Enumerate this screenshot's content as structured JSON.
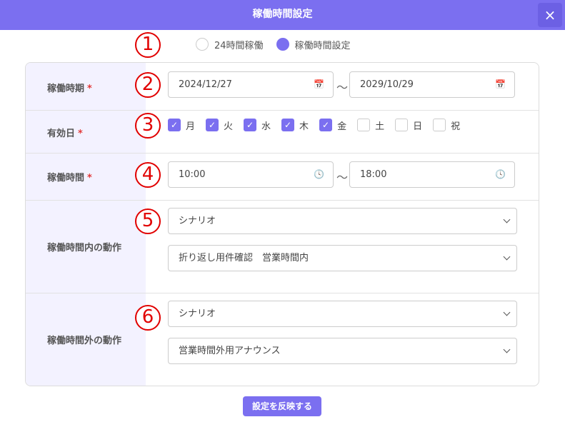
{
  "header": {
    "title": "稼働時間設定",
    "close_icon": "×"
  },
  "markers": [
    "1",
    "2",
    "3",
    "4",
    "5",
    "6"
  ],
  "mode": {
    "options": [
      {
        "label": "24時間稼働",
        "checked": false
      },
      {
        "label": "稼働時間設定",
        "checked": true
      }
    ]
  },
  "period": {
    "label": "稼働時期",
    "required_mark": "*",
    "start": "2024/12/27",
    "end": "2029/10/29",
    "separator": "～"
  },
  "valid_days": {
    "label": "有効日",
    "required_mark": "*",
    "days": [
      {
        "label": "月",
        "checked": true
      },
      {
        "label": "火",
        "checked": true
      },
      {
        "label": "水",
        "checked": true
      },
      {
        "label": "木",
        "checked": true
      },
      {
        "label": "金",
        "checked": true
      },
      {
        "label": "土",
        "checked": false
      },
      {
        "label": "日",
        "checked": false
      },
      {
        "label": "祝",
        "checked": false
      }
    ]
  },
  "hours": {
    "label": "稼働時間",
    "required_mark": "*",
    "start": "10:00",
    "end": "18:00",
    "separator": "～"
  },
  "inside_action": {
    "label": "稼働時間内の動作",
    "type": "シナリオ",
    "value": "折り返し用件確認　営業時間内"
  },
  "outside_action": {
    "label": "稼働時間外の動作",
    "type": "シナリオ",
    "value": "営業時間外用アナウンス"
  },
  "apply_button": "設定を反映する",
  "colors": {
    "accent": "#7b6ff0",
    "marker": "#e10000",
    "label_bg": "#f3f2ff",
    "required": "#e23a3a"
  }
}
